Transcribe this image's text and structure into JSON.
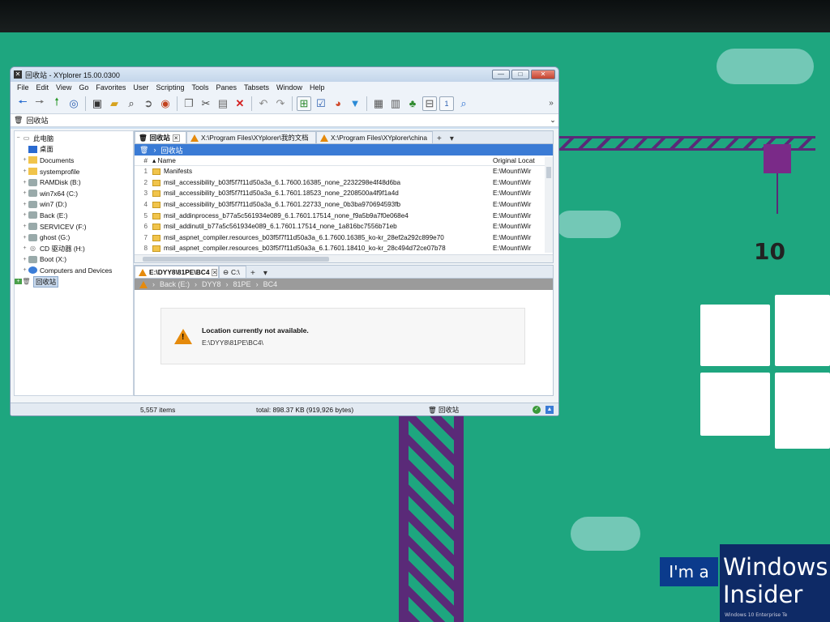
{
  "window": {
    "title": "回收站 - XYplorer 15.00.0300",
    "buttons": {
      "minimize": "—",
      "maximize": "□",
      "close": "✕"
    }
  },
  "menu": [
    "File",
    "Edit",
    "View",
    "Go",
    "Favorites",
    "User",
    "Scripting",
    "Tools",
    "Panes",
    "Tabsets",
    "Window",
    "Help"
  ],
  "toolbar": {
    "icons": [
      "back-arrow-icon",
      "forward-arrow-icon",
      "up-arrow-icon",
      "target-icon",
      "computer-icon",
      "folder-open-icon",
      "find-icon",
      "forward-circle-icon",
      "recycle-circle-icon",
      "copy-icon",
      "cut-icon",
      "paste-icon",
      "delete-icon",
      "undo-icon",
      "redo-icon",
      "tree-view-icon",
      "checkbox-icon",
      "pie-chart-icon",
      "filter-icon",
      "thumbnails-icon",
      "details-view-icon",
      "tree-icon",
      "dual-pane-icon",
      "pane-1-icon",
      "search-icon"
    ],
    "pane_number": "1",
    "more": "»"
  },
  "address": {
    "value": "回收站"
  },
  "tree": {
    "items": [
      {
        "label": "此电脑",
        "icon": "computer-icon"
      },
      {
        "label": "桌面",
        "icon": "desktop-icon"
      },
      {
        "label": "Documents",
        "icon": "folder-icon"
      },
      {
        "label": "systemprofile",
        "icon": "folder-icon"
      },
      {
        "label": "RAMDisk (B:)",
        "icon": "drive-icon"
      },
      {
        "label": "win7x64 (C:)",
        "icon": "drive-icon"
      },
      {
        "label": "win7 (D:)",
        "icon": "drive-icon"
      },
      {
        "label": "Back (E:)",
        "icon": "drive-icon"
      },
      {
        "label": "SERVICEV (F:)",
        "icon": "drive-icon"
      },
      {
        "label": "ghost (G:)",
        "icon": "drive-icon"
      },
      {
        "label": "CD 驱动器 (H:)",
        "icon": "cd-drive-icon"
      },
      {
        "label": "Boot (X:)",
        "icon": "drive-icon"
      },
      {
        "label": "Computers and Devices",
        "icon": "network-icon"
      },
      {
        "label": "回收站",
        "icon": "recycle-bin-icon"
      }
    ]
  },
  "top_pane": {
    "tabs": [
      {
        "label": "回收站",
        "active": true
      },
      {
        "label": "X:\\Program Files\\XYplorer\\我的文档"
      },
      {
        "label": "X:\\Program Files\\XYplorer\\china"
      }
    ],
    "breadcrumb": "回收站",
    "columns": {
      "num": "#",
      "name": "Name",
      "orig": "Original Locat"
    },
    "rows": [
      {
        "n": "1",
        "name": "Manifests",
        "orig": "E:\\Mount\\Wir"
      },
      {
        "n": "2",
        "name": "msil_accessibility_b03f5f7f11d50a3a_6.1.7600.16385_none_2232298e4f48d6ba",
        "orig": "E:\\Mount\\Wir"
      },
      {
        "n": "3",
        "name": "msil_accessibility_b03f5f7f11d50a3a_6.1.7601.18523_none_2208500a4f9f1a4d",
        "orig": "E:\\Mount\\Wir"
      },
      {
        "n": "4",
        "name": "msil_accessibility_b03f5f7f11d50a3a_6.1.7601.22733_none_0b3ba970694593fb",
        "orig": "E:\\Mount\\Wir"
      },
      {
        "n": "5",
        "name": "msil_addinprocess_b77a5c561934e089_6.1.7601.17514_none_f9a5b9a7f0e068e4",
        "orig": "E:\\Mount\\Wir"
      },
      {
        "n": "6",
        "name": "msil_addinutil_b77a5c561934e089_6.1.7601.17514_none_1a816bc7556b71eb",
        "orig": "E:\\Mount\\Wir"
      },
      {
        "n": "7",
        "name": "msil_aspnet_compiler.resources_b03f5f7f11d50a3a_6.1.7600.16385_ko-kr_28ef2a292c899e70",
        "orig": "E:\\Mount\\Wir"
      },
      {
        "n": "8",
        "name": "msil_aspnet_compiler.resources_b03f5f7f11d50a3a_6.1.7601.18410_ko-kr_28c494d72ce07b78",
        "orig": "E:\\Mount\\Wir"
      }
    ]
  },
  "bottom_pane": {
    "tabs": [
      {
        "label": "E:\\DYY8\\81PE\\BC4",
        "active": true
      },
      {
        "label": "C:\\"
      }
    ],
    "breadcrumb": [
      "Back (E:)",
      "DYY8",
      "81PE",
      "BC4"
    ],
    "message": {
      "title": "Location currently not available.",
      "path": "E:\\DYY8\\81PE\\BC4\\"
    }
  },
  "status": {
    "items": "5,557 items",
    "total": "total: 898.37 KB (919,926 bytes)",
    "location": "回收站"
  },
  "desktop": {
    "hook_text": "10",
    "insider": {
      "im": "I'm a",
      "line1": "Windows",
      "line2": "Insider",
      "small": "Windows 10 Enterprise Te"
    }
  },
  "colors": {
    "desktop_bg": "#1ea67f",
    "crane": "#5a2a78",
    "accent": "#3a7bd5",
    "warning": "#e58a0c"
  }
}
